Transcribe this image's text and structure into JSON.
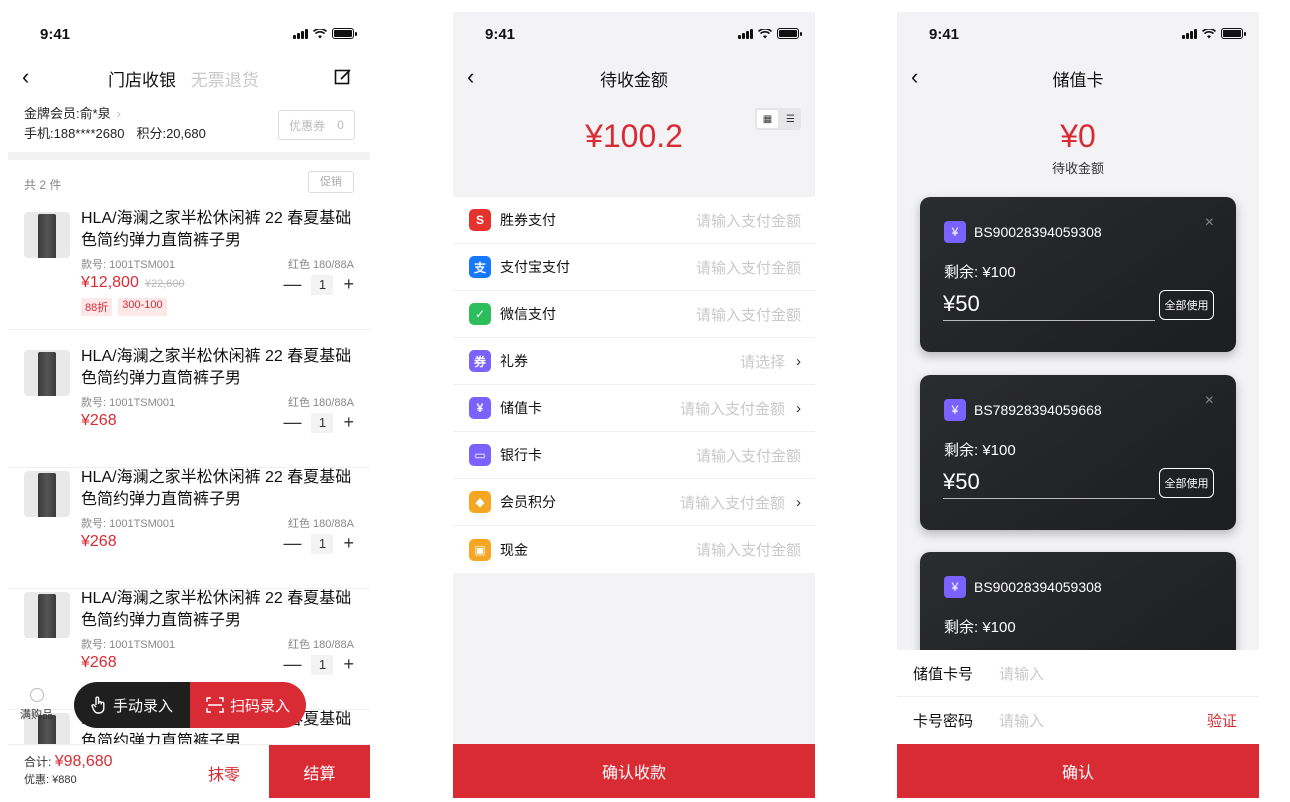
{
  "status": {
    "time": "9:41"
  },
  "screen1": {
    "tab_active": "门店收银",
    "tab_inactive": "无票退货",
    "member": "金牌会员:俞*泉",
    "phone": "手机:188****2680",
    "points": "积分:20,680",
    "coupon_label": "优惠券",
    "coupon_count": "0",
    "item_count": "共 2 件",
    "promo_label": "促销",
    "products": [
      {
        "name": "HLA/海澜之家半松休闲裤 22 春夏基础色简约弹力直筒裤子男",
        "sku": "款号: 1001TSM001",
        "spec": "红色  180/88A",
        "price": "¥12,800",
        "orig": "¥22,600",
        "qty": "1",
        "tags": [
          "88折",
          "300-100"
        ]
      },
      {
        "name": "HLA/海澜之家半松休闲裤 22 春夏基础色简约弹力直筒裤子男",
        "sku": "款号: 1001TSM001",
        "spec": "红色  180/88A",
        "price": "¥268",
        "orig": "",
        "qty": "1",
        "tags": []
      },
      {
        "name": "HLA/海澜之家半松休闲裤 22 春夏基础色简约弹力直筒裤子男",
        "sku": "款号: 1001TSM001",
        "spec": "红色  180/88A",
        "price": "¥268",
        "orig": "",
        "qty": "1",
        "tags": []
      },
      {
        "name": "HLA/海澜之家半松休闲裤 22 春夏基础色简约弹力直筒裤子男",
        "sku": "款号: 1001TSM001",
        "spec": "红色  180/88A",
        "price": "¥268",
        "orig": "",
        "qty": "1",
        "tags": []
      },
      {
        "name": "HLA/海澜之家半松休闲裤 22 春夏基础色简约弹力直筒裤子男",
        "sku": "",
        "spec": "",
        "price": "",
        "orig": "",
        "qty": "",
        "tags": []
      }
    ],
    "full_gift": "满购品",
    "manual_entry": "手动录入",
    "scan_entry": "扫码录入",
    "total_label": "合计:",
    "total_amount": "¥98,680",
    "discount": "优惠: ¥880",
    "round_off": "抹零",
    "checkout": "结算"
  },
  "screen2": {
    "title": "待收金额",
    "amount": "¥100.2",
    "methods": [
      {
        "label": "胜券支付",
        "placeholder": "请输入支付金额",
        "arrow": false,
        "icon": "S",
        "color": "#e5322d"
      },
      {
        "label": "支付宝支付",
        "placeholder": "请输入支付金额",
        "arrow": false,
        "icon": "支",
        "color": "#1677ff"
      },
      {
        "label": "微信支付",
        "placeholder": "请输入支付金额",
        "arrow": false,
        "icon": "✓",
        "color": "#2dbd5a"
      },
      {
        "label": "礼券",
        "placeholder": "请选择",
        "arrow": true,
        "icon": "券",
        "color": "#7b61ff"
      },
      {
        "label": "储值卡",
        "placeholder": "请输入支付金额",
        "arrow": true,
        "icon": "¥",
        "color": "#7b61ff"
      },
      {
        "label": "银行卡",
        "placeholder": "请输入支付金额",
        "arrow": false,
        "icon": "▭",
        "color": "#7b61ff"
      },
      {
        "label": "会员积分",
        "placeholder": "请输入支付金额",
        "arrow": true,
        "icon": "◆",
        "color": "#f5a623"
      },
      {
        "label": "现金",
        "placeholder": "请输入支付金额",
        "arrow": false,
        "icon": "▣",
        "color": "#f5a623"
      }
    ],
    "confirm": "确认收款"
  },
  "screen3": {
    "title": "储值卡",
    "amount": "¥0",
    "sub": "待收金额",
    "cards": [
      {
        "number": "BS90028394059308",
        "remain": "剩余: ¥100",
        "value": "¥50",
        "use_all": "全部使用"
      },
      {
        "number": "BS78928394059668",
        "remain": "剩余: ¥100",
        "value": "¥50",
        "use_all": "全部使用"
      },
      {
        "number": "BS90028394059308",
        "remain": "剩余: ¥100",
        "value": "",
        "use_all": ""
      }
    ],
    "card_no_label": "储值卡号",
    "card_no_placeholder": "请输入",
    "pwd_label": "卡号密码",
    "pwd_placeholder": "请输入",
    "verify": "验证",
    "confirm": "确认"
  },
  "colors": {
    "accent": "#d92b34",
    "card_icon": "#7b61ff"
  }
}
